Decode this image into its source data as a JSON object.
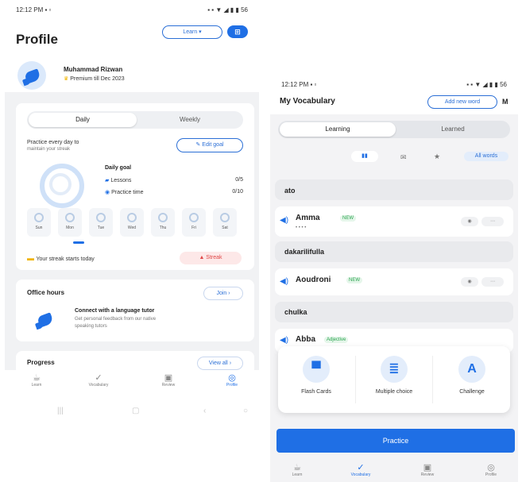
{
  "left": {
    "status_left": "12:12 PM ▪ ▫",
    "status_right": "▪ ▪ ▼ ◢ ▮ ▮ 56",
    "title": "Profile",
    "header_button": "Learn ▾",
    "header_badge": "⊞",
    "profile_name": "Muhammad Rizwan",
    "profile_sub": "Premium till Dec 2023",
    "seg_daily": "Daily",
    "seg_weekly": "Weekly",
    "goal_line1": "Practice every day to",
    "goal_line2": "maintain your streak",
    "goal_button": "Edit goal",
    "stats_title": "Daily goal",
    "stat1_label": "Lessons",
    "stat1_value": "0/5",
    "stat2_label": "Practice time",
    "stat2_value": "0/10",
    "days": [
      "Sun",
      "Mon",
      "Tue",
      "Wed",
      "Thu",
      "Fri",
      "Sat"
    ],
    "streak_text": "Your streak starts today",
    "streak_button": "▲ Streak",
    "office_title": "Office hours",
    "office_button": "Join ›",
    "office_name": "Connect with a language tutor",
    "office_desc1": "Get personal feedback from our native",
    "office_desc2": "speaking tutors",
    "progress_title": "Progress",
    "progress_button": "View all ›",
    "tabs": [
      "Learn",
      "Vocabulary",
      "Review",
      "Profile"
    ],
    "nav": [
      "|||",
      "▢",
      "‹",
      "○"
    ]
  },
  "right": {
    "status_left": "12:12 PM ▪ ▫",
    "status_right": "▪ ▪ ▼ ◢ ▮ ▮ 56",
    "title": "My Vocabulary",
    "add_button": "Add new word",
    "add_icon": "M",
    "seg_learning": "Learning",
    "seg_learned": "Learned",
    "filter_active": "▮▮",
    "filter_all": "All words",
    "rows": [
      {
        "word": "ato"
      },
      {
        "word": "Amma",
        "tag": "NEW",
        "dots": "• • • •"
      },
      {
        "word": "dakarilifulla"
      },
      {
        "word": "Aoudroni",
        "tag": "NEW"
      },
      {
        "word": "chulka"
      },
      {
        "word": "Abba",
        "tag": "Adjective"
      }
    ],
    "options": [
      {
        "icon": "▀",
        "label": "Flash Cards"
      },
      {
        "icon": "≣",
        "label": "Multiple choice"
      },
      {
        "icon": "A",
        "label": "Challenge"
      }
    ],
    "practice_button": "Practice",
    "tabs": [
      "Learn",
      "Vocabulary",
      "Review",
      "Profile"
    ]
  },
  "colors": {
    "accent": "#1f6fe5",
    "green": "#2aa44f",
    "red": "#e04848"
  }
}
